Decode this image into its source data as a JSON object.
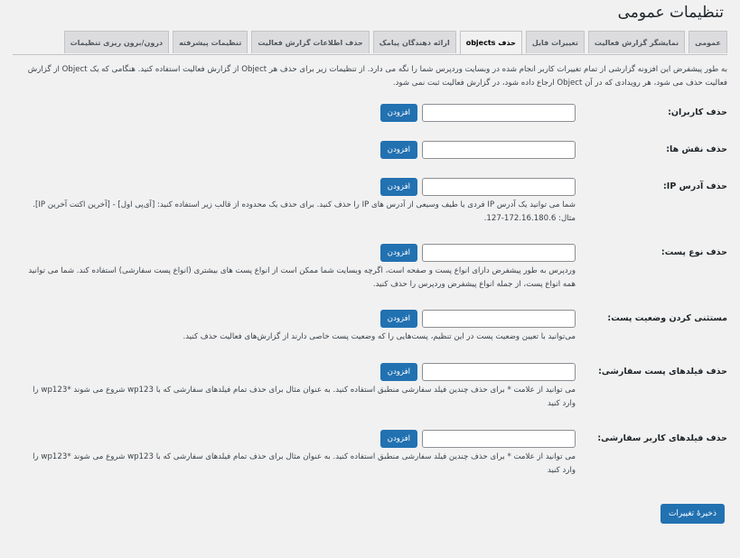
{
  "page_title": "تنظیمات عمومی",
  "tabs": [
    {
      "label": "عمومی",
      "active": false
    },
    {
      "label": "نمایشگر گزارش فعالیت",
      "active": false
    },
    {
      "label": "تغییرات فایل",
      "active": false
    },
    {
      "label": "حذف objects",
      "active": true
    },
    {
      "label": "ارائه دهندگان پیامک",
      "active": false
    },
    {
      "label": "حذف اطلاعات گزارش فعالیت",
      "active": false
    },
    {
      "label": "تنظیمات پیشرفته",
      "active": false
    },
    {
      "label": "درون/برون ریزی تنظیمات",
      "active": false
    }
  ],
  "intro": "به طور پیشفرض این افزونه گزارشی از تمام تغییرات کاربر انجام شده در وبسایت وردپرس شما را نگه می دارد. از تنظیمات زیر برای حذف هر Object از گزارش فعالیت استفاده کنید. هنگامی که یک Object از گزارش فعالیت حذف می شود، هر رویدادی که در آن Object ارجاع داده شود، در گزارش فعالیت ثبت نمی شود.",
  "add_label": "افزودن",
  "rows": [
    {
      "label": "حذف کاربران:",
      "value": "",
      "help": ""
    },
    {
      "label": "حذف نقش ها:",
      "value": "",
      "help": ""
    },
    {
      "label": "حذف آدرس IP:",
      "value": "",
      "help": "شما می توانید یک آدرس IP فردی یا طیف وسیعی از آدرس های IP را حذف کنید. برای حذف یک محدوده از قالب زیر استفاده کنید: [آی‌پی اول] - [آخرین اکتت آخرین IP]. مثال: 172.16.180.6-127."
    },
    {
      "label": "حذف نوع پست:",
      "value": "",
      "help": "وردپرس به طور پیشفرض دارای انواع پست و صفحه است، اگرچه وبسایت شما ممکن است از انواع پست های بیشتری (انواع پست سفارشی) استفاده کند. شما می توانید همه انواع پست، از جمله انواع پیشفرض وردپرس را حذف کنید."
    },
    {
      "label": "مستثنی کردن وضعیت پست:",
      "value": "",
      "help": "می‌توانید با تعیین وضعیت پست در این تنظیم، پست‌هایی را که وضعیت پست خاصی دارند از گزارش‌های فعالیت حذف کنید."
    },
    {
      "label": "حذف فیلدهای پست سفارشی:",
      "value": "",
      "help": "می توانید از علامت * برای حذف چندین فیلد سفارشی منطبق استفاده کنید. به عنوان مثال برای حذف تمام فیلدهای سفارشی که با wp123 شروع می شوند *wp123 را وارد کنید"
    },
    {
      "label": "حذف فیلدهای کاربر سفارشی:",
      "value": "",
      "help": "می توانید از علامت * برای حذف چندین فیلد سفارشی منطبق استفاده کنید. به عنوان مثال برای حذف تمام فیلدهای سفارشی که با wp123 شروع می شوند *wp123 را وارد کنید"
    }
  ],
  "save_label": "ذخیرهٔ تغییرات",
  "colors": {
    "accent": "#2271b1",
    "background": "#f1f1f1"
  }
}
